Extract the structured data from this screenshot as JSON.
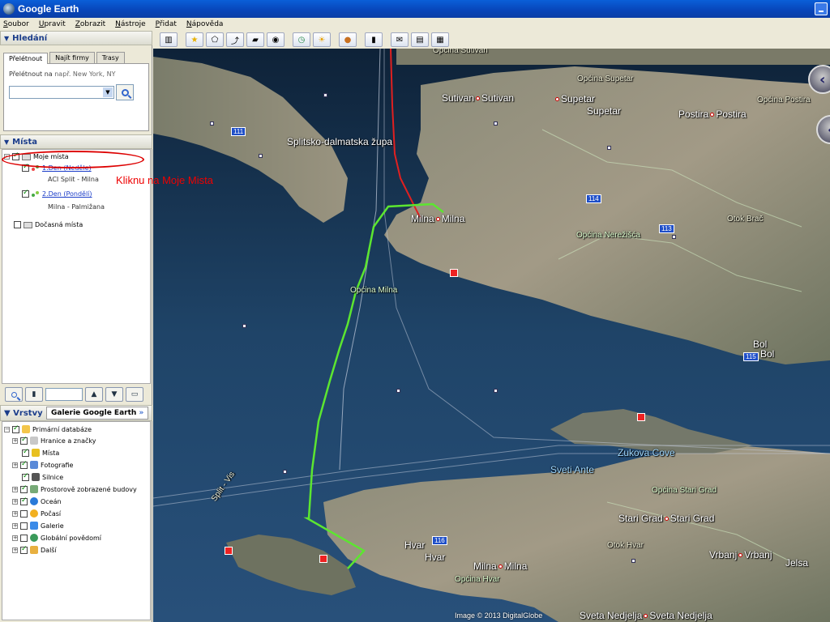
{
  "window": {
    "title": "Google Earth"
  },
  "menu": [
    "Soubor",
    "Upravit",
    "Zobrazit",
    "Nástroje",
    "Přidat",
    "Nápověda"
  ],
  "search": {
    "header": "Hledání",
    "tabs": [
      "Přelétnout",
      "Najít firmy",
      "Trasy"
    ],
    "hint_label": "Přelétnout na",
    "hint_example": "např. New York, NY",
    "input_value": ""
  },
  "places": {
    "header": "Místa",
    "my_places": "Moje místa",
    "item1_title": "1.Den (Neděle)",
    "item1_sub": "ACI Split - Milna",
    "item2_title": "2.Den (Pondělí)",
    "item2_sub": "Milna - Palmižana",
    "temp_places": "Dočasná místa"
  },
  "annotation": {
    "text": "Kliknu na Moje Mista",
    "color": "#e00000"
  },
  "layers": {
    "header": "Vrstvy",
    "gallery_tab": "Galerie Google Earth",
    "gallery_arrows": "»",
    "root": "Primární databáze",
    "items": [
      {
        "label": "Hranice a značky",
        "checked": true
      },
      {
        "label": "Místa",
        "checked": true
      },
      {
        "label": "Fotografie",
        "checked": true
      },
      {
        "label": "Silnice",
        "checked": true
      },
      {
        "label": "Prostorově zobrazené budovy",
        "checked": true
      },
      {
        "label": "Oceán",
        "checked": true
      },
      {
        "label": "Počasí",
        "checked": false
      },
      {
        "label": "Galerie",
        "checked": false
      },
      {
        "label": "Globální povědomí",
        "checked": false
      },
      {
        "label": "Další",
        "checked": true
      }
    ]
  },
  "map": {
    "labels": {
      "opcina_sutivan": "Općina Sutivan",
      "opcina_supetar": "Općina Supetar",
      "opcina_postira": "Općina Postira",
      "sutivan": "Sutivan",
      "supetar": "Supetar",
      "supetar2": "Supetar",
      "postira": "Postira",
      "splitsko": "Splitsko-dalmatska župa",
      "milna": "Milna",
      "otok_brac": "Otok Brač",
      "opcina_nerezisca": "Općina Nerežišća",
      "opcina_milna": "Općina Milna",
      "bol": "Bol",
      "zukova_cove": "Zukova Cove",
      "sveti_ante": "Sveti Ante",
      "opcina_stari_grad": "Općina Stari Grad",
      "stari_grad": "Stari Grad",
      "otok_hvar": "Otok Hvar",
      "vrbanj": "Vrbanj",
      "jelsa": "Jelsa",
      "hvar": "Hvar",
      "hvar2": "Hvar",
      "milna_hvar": "Milna",
      "opcina_hvar": "Općina Hvar",
      "sveta_nedjelja": "Sveta Nedjelja",
      "split_vis": "Split - Vis"
    },
    "shields": [
      "111",
      "114",
      "113",
      "115",
      "116"
    ],
    "copyright": "Image © 2013 DigitalGlobe",
    "route_colors": {
      "day1": "#e02020",
      "day2": "#5ce630"
    }
  }
}
